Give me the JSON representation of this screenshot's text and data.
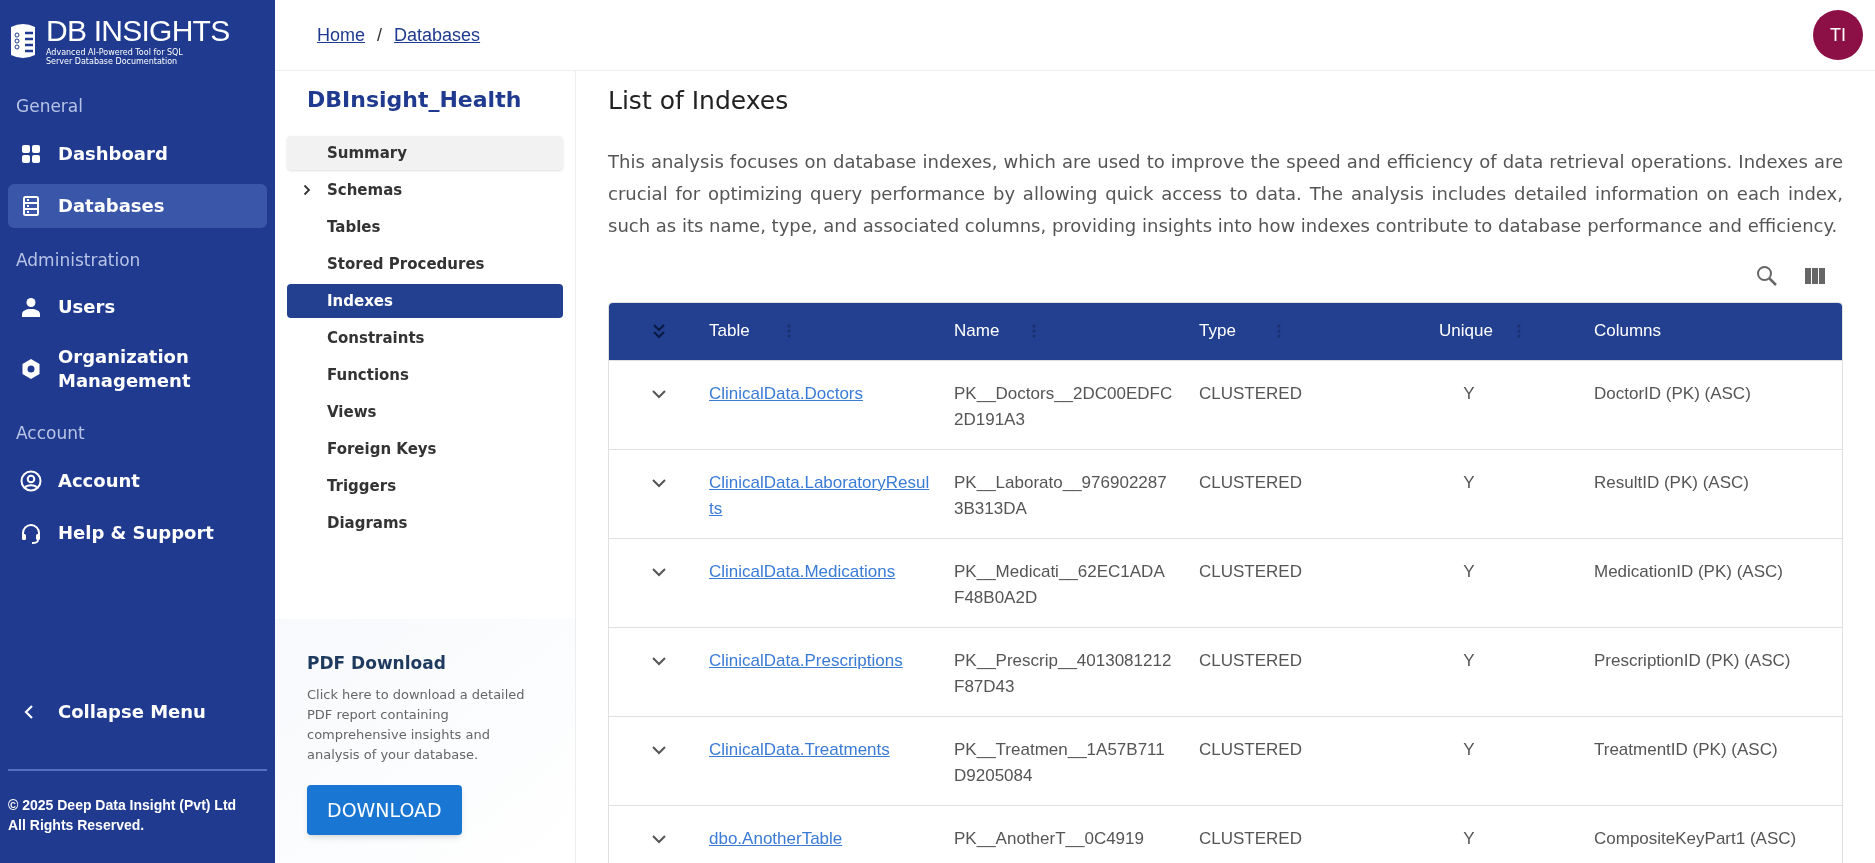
{
  "logo": {
    "title": "DB INSIGHTS",
    "tagline": "Advanced AI-Powered Tool for SQL Server Database Documentation"
  },
  "nav_sections": [
    {
      "heading": "General",
      "items": [
        {
          "label": "Dashboard",
          "selected": false
        },
        {
          "label": "Databases",
          "selected": true
        }
      ]
    },
    {
      "heading": "Administration",
      "items": [
        {
          "label": "Users",
          "selected": false
        },
        {
          "label": "Organization Management",
          "selected": false
        }
      ]
    },
    {
      "heading": "Account",
      "items": [
        {
          "label": "Account",
          "selected": false
        },
        {
          "label": "Help & Support",
          "selected": false
        }
      ]
    }
  ],
  "collapse_menu": "Collapse Menu",
  "footer": [
    "© 2025 Deep Data Insight (Pvt) Ltd",
    "All Rights Reserved."
  ],
  "breadcrumb": [
    "Home",
    "Databases"
  ],
  "breadcrumb_separator": "/",
  "avatar": "TI",
  "database": {
    "name": "DBInsight_Health",
    "items": [
      {
        "label": "Summary",
        "expandable": false,
        "hovered": true,
        "selected": false
      },
      {
        "label": "Schemas",
        "expandable": true,
        "hovered": false,
        "selected": false
      },
      {
        "label": "Tables",
        "expandable": false,
        "hovered": false,
        "selected": false
      },
      {
        "label": "Stored Procedures",
        "expandable": false,
        "hovered": false,
        "selected": false
      },
      {
        "label": "Indexes",
        "expandable": false,
        "hovered": false,
        "selected": true
      },
      {
        "label": "Constraints",
        "expandable": false,
        "hovered": false,
        "selected": false
      },
      {
        "label": "Functions",
        "expandable": false,
        "hovered": false,
        "selected": false
      },
      {
        "label": "Views",
        "expandable": false,
        "hovered": false,
        "selected": false
      },
      {
        "label": "Foreign Keys",
        "expandable": false,
        "hovered": false,
        "selected": false
      },
      {
        "label": "Triggers",
        "expandable": false,
        "hovered": false,
        "selected": false
      },
      {
        "label": "Diagrams",
        "expandable": false,
        "hovered": false,
        "selected": false
      }
    ]
  },
  "pdf": {
    "title": "PDF Download",
    "text": "Click here to download a detailed PDF report containing comprehensive insights and analysis of your database.",
    "button": "DOWNLOAD"
  },
  "page_title": "List of Indexes",
  "description": "This analysis focuses on database indexes, which are used to improve the speed and efficiency of data retrieval operations. Indexes are crucial for optimizing query performance by allowing quick access to data. The analysis includes detailed information on each index, such as its name, type, and associated columns, providing insights into how indexes contribute to database performance and efficiency.",
  "table": {
    "columns": [
      "Table",
      "Name",
      "Type",
      "Unique",
      "Columns"
    ],
    "rows": [
      {
        "table": "ClinicalData.Doctors",
        "name": "PK__Doctors__2DC00EDFC2D191A3",
        "type": "CLUSTERED",
        "unique": "Y",
        "columns": "DoctorID (PK) (ASC)"
      },
      {
        "table": "ClinicalData.LaboratoryResults",
        "name": "PK__Laborato__9769022873B313DA",
        "type": "CLUSTERED",
        "unique": "Y",
        "columns": "ResultID (PK) (ASC)"
      },
      {
        "table": "ClinicalData.Medications",
        "name": "PK__Medicati__62EC1ADAF48B0A2D",
        "type": "CLUSTERED",
        "unique": "Y",
        "columns": "MedicationID (PK) (ASC)"
      },
      {
        "table": "ClinicalData.Prescriptions",
        "name": "PK__Prescrip__4013081212F87D43",
        "type": "CLUSTERED",
        "unique": "Y",
        "columns": "PrescriptionID (PK) (ASC)"
      },
      {
        "table": "ClinicalData.Treatments",
        "name": "PK__Treatmen__1A57B711D9205084",
        "type": "CLUSTERED",
        "unique": "Y",
        "columns": "TreatmentID (PK) (ASC)"
      },
      {
        "table": "dbo.AnotherTable",
        "name": "PK__AnotherT__0C4919",
        "type": "CLUSTERED",
        "unique": "Y",
        "columns": "CompositeKeyPart1 (ASC)"
      }
    ]
  }
}
